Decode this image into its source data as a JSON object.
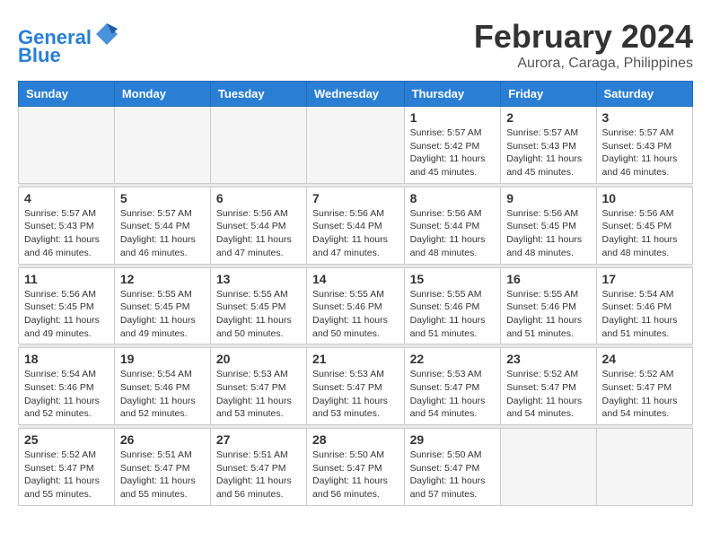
{
  "logo": {
    "line1": "General",
    "line2": "Blue"
  },
  "title": "February 2024",
  "location": "Aurora, Caraga, Philippines",
  "weekdays": [
    "Sunday",
    "Monday",
    "Tuesday",
    "Wednesday",
    "Thursday",
    "Friday",
    "Saturday"
  ],
  "weeks": [
    [
      {
        "day": "",
        "sunrise": "",
        "sunset": "",
        "daylight": ""
      },
      {
        "day": "",
        "sunrise": "",
        "sunset": "",
        "daylight": ""
      },
      {
        "day": "",
        "sunrise": "",
        "sunset": "",
        "daylight": ""
      },
      {
        "day": "",
        "sunrise": "",
        "sunset": "",
        "daylight": ""
      },
      {
        "day": "1",
        "sunrise": "Sunrise: 5:57 AM",
        "sunset": "Sunset: 5:42 PM",
        "daylight": "Daylight: 11 hours and 45 minutes."
      },
      {
        "day": "2",
        "sunrise": "Sunrise: 5:57 AM",
        "sunset": "Sunset: 5:43 PM",
        "daylight": "Daylight: 11 hours and 45 minutes."
      },
      {
        "day": "3",
        "sunrise": "Sunrise: 5:57 AM",
        "sunset": "Sunset: 5:43 PM",
        "daylight": "Daylight: 11 hours and 46 minutes."
      }
    ],
    [
      {
        "day": "4",
        "sunrise": "Sunrise: 5:57 AM",
        "sunset": "Sunset: 5:43 PM",
        "daylight": "Daylight: 11 hours and 46 minutes."
      },
      {
        "day": "5",
        "sunrise": "Sunrise: 5:57 AM",
        "sunset": "Sunset: 5:44 PM",
        "daylight": "Daylight: 11 hours and 46 minutes."
      },
      {
        "day": "6",
        "sunrise": "Sunrise: 5:56 AM",
        "sunset": "Sunset: 5:44 PM",
        "daylight": "Daylight: 11 hours and 47 minutes."
      },
      {
        "day": "7",
        "sunrise": "Sunrise: 5:56 AM",
        "sunset": "Sunset: 5:44 PM",
        "daylight": "Daylight: 11 hours and 47 minutes."
      },
      {
        "day": "8",
        "sunrise": "Sunrise: 5:56 AM",
        "sunset": "Sunset: 5:44 PM",
        "daylight": "Daylight: 11 hours and 48 minutes."
      },
      {
        "day": "9",
        "sunrise": "Sunrise: 5:56 AM",
        "sunset": "Sunset: 5:45 PM",
        "daylight": "Daylight: 11 hours and 48 minutes."
      },
      {
        "day": "10",
        "sunrise": "Sunrise: 5:56 AM",
        "sunset": "Sunset: 5:45 PM",
        "daylight": "Daylight: 11 hours and 48 minutes."
      }
    ],
    [
      {
        "day": "11",
        "sunrise": "Sunrise: 5:56 AM",
        "sunset": "Sunset: 5:45 PM",
        "daylight": "Daylight: 11 hours and 49 minutes."
      },
      {
        "day": "12",
        "sunrise": "Sunrise: 5:55 AM",
        "sunset": "Sunset: 5:45 PM",
        "daylight": "Daylight: 11 hours and 49 minutes."
      },
      {
        "day": "13",
        "sunrise": "Sunrise: 5:55 AM",
        "sunset": "Sunset: 5:45 PM",
        "daylight": "Daylight: 11 hours and 50 minutes."
      },
      {
        "day": "14",
        "sunrise": "Sunrise: 5:55 AM",
        "sunset": "Sunset: 5:46 PM",
        "daylight": "Daylight: 11 hours and 50 minutes."
      },
      {
        "day": "15",
        "sunrise": "Sunrise: 5:55 AM",
        "sunset": "Sunset: 5:46 PM",
        "daylight": "Daylight: 11 hours and 51 minutes."
      },
      {
        "day": "16",
        "sunrise": "Sunrise: 5:55 AM",
        "sunset": "Sunset: 5:46 PM",
        "daylight": "Daylight: 11 hours and 51 minutes."
      },
      {
        "day": "17",
        "sunrise": "Sunrise: 5:54 AM",
        "sunset": "Sunset: 5:46 PM",
        "daylight": "Daylight: 11 hours and 51 minutes."
      }
    ],
    [
      {
        "day": "18",
        "sunrise": "Sunrise: 5:54 AM",
        "sunset": "Sunset: 5:46 PM",
        "daylight": "Daylight: 11 hours and 52 minutes."
      },
      {
        "day": "19",
        "sunrise": "Sunrise: 5:54 AM",
        "sunset": "Sunset: 5:46 PM",
        "daylight": "Daylight: 11 hours and 52 minutes."
      },
      {
        "day": "20",
        "sunrise": "Sunrise: 5:53 AM",
        "sunset": "Sunset: 5:47 PM",
        "daylight": "Daylight: 11 hours and 53 minutes."
      },
      {
        "day": "21",
        "sunrise": "Sunrise: 5:53 AM",
        "sunset": "Sunset: 5:47 PM",
        "daylight": "Daylight: 11 hours and 53 minutes."
      },
      {
        "day": "22",
        "sunrise": "Sunrise: 5:53 AM",
        "sunset": "Sunset: 5:47 PM",
        "daylight": "Daylight: 11 hours and 54 minutes."
      },
      {
        "day": "23",
        "sunrise": "Sunrise: 5:52 AM",
        "sunset": "Sunset: 5:47 PM",
        "daylight": "Daylight: 11 hours and 54 minutes."
      },
      {
        "day": "24",
        "sunrise": "Sunrise: 5:52 AM",
        "sunset": "Sunset: 5:47 PM",
        "daylight": "Daylight: 11 hours and 54 minutes."
      }
    ],
    [
      {
        "day": "25",
        "sunrise": "Sunrise: 5:52 AM",
        "sunset": "Sunset: 5:47 PM",
        "daylight": "Daylight: 11 hours and 55 minutes."
      },
      {
        "day": "26",
        "sunrise": "Sunrise: 5:51 AM",
        "sunset": "Sunset: 5:47 PM",
        "daylight": "Daylight: 11 hours and 55 minutes."
      },
      {
        "day": "27",
        "sunrise": "Sunrise: 5:51 AM",
        "sunset": "Sunset: 5:47 PM",
        "daylight": "Daylight: 11 hours and 56 minutes."
      },
      {
        "day": "28",
        "sunrise": "Sunrise: 5:50 AM",
        "sunset": "Sunset: 5:47 PM",
        "daylight": "Daylight: 11 hours and 56 minutes."
      },
      {
        "day": "29",
        "sunrise": "Sunrise: 5:50 AM",
        "sunset": "Sunset: 5:47 PM",
        "daylight": "Daylight: 11 hours and 57 minutes."
      },
      {
        "day": "",
        "sunrise": "",
        "sunset": "",
        "daylight": ""
      },
      {
        "day": "",
        "sunrise": "",
        "sunset": "",
        "daylight": ""
      }
    ]
  ]
}
